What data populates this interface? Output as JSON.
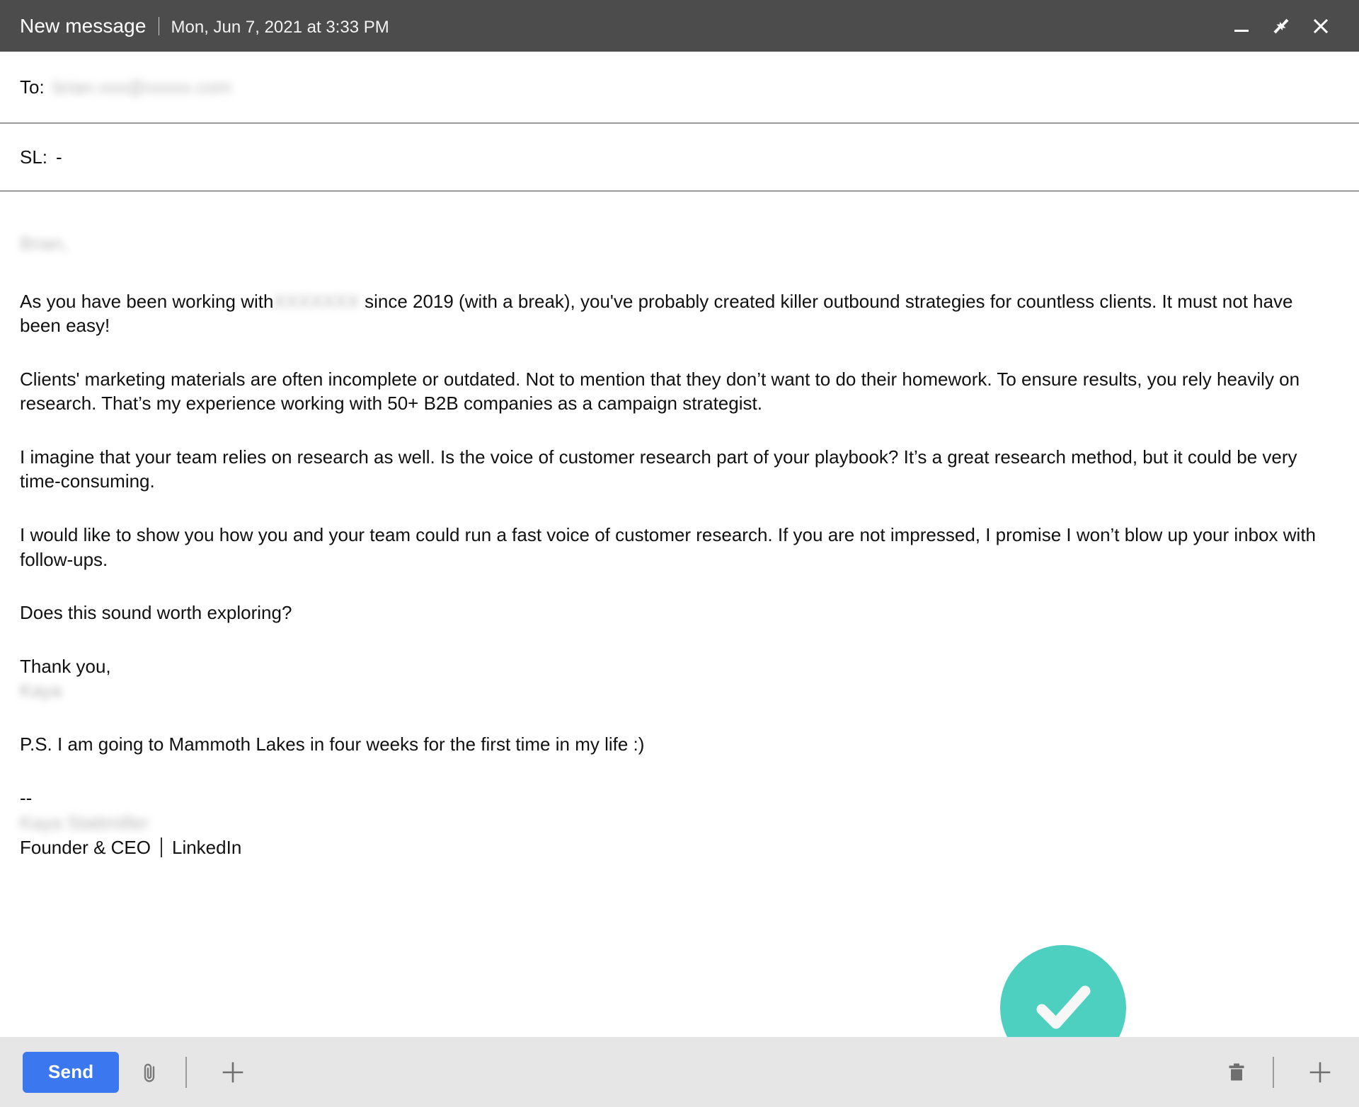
{
  "window": {
    "title": "New message",
    "separator": "|",
    "date": "Mon, Jun 7, 2021 at 3:33 PM",
    "controls": {
      "minimize": "minimize-icon",
      "collapse": "collapse-inward-icon",
      "close": "close-icon"
    }
  },
  "fields": {
    "to_label": "To:",
    "to_value": "brian.xxx@xxxxx.com",
    "sl_label": "SL:",
    "sl_value": "-"
  },
  "body": {
    "greeting": "Brian,",
    "paragraph_1_before": "As you have been working with",
    "paragraph_1_redacted": "XXXXXXX",
    "paragraph_1_after": "since 2019 (with a break), you've probably created killer outbound strategies for countless clients. It must not have been easy!",
    "paragraph_2": "Clients' marketing materials are often incomplete or outdated. Not to mention that they don’t want to do their homework. To ensure results, you rely heavily on research. That’s my experience working with 50+ B2B companies as a campaign strategist.",
    "paragraph_3": "I imagine that your team relies on research as well. Is the voice of customer research part of your playbook? It’s a great research method, but it could be very time-consuming.",
    "paragraph_4": "I would like to show you how you and your team could run a fast voice of customer research. If you are not impressed, I promise I won’t blow up your inbox with follow-ups.",
    "paragraph_5": "Does this sound worth exploring?",
    "closing": "Thank you,",
    "signer_first_name": "Kaya",
    "postscript": "P.S. I am going to Mammoth Lakes in four weeks for the first time in my life :)",
    "signature_dashes": "--",
    "signature_name": "Kaya Stattmiller",
    "signature_role": "Founder & CEO",
    "signature_sep": "|",
    "signature_link": "LinkedIn"
  },
  "overlay": {
    "status_icon": "success-check-icon",
    "status_color": "#4ed0c0",
    "check_color": "#f7f7f7"
  },
  "toolbar": {
    "send_label": "Send",
    "attach_icon": "paperclip-icon",
    "add_left_icon": "plus-icon",
    "delete_icon": "trash-icon",
    "add_right_icon": "plus-icon"
  },
  "colors": {
    "titlebar_bg": "#4c4c4c",
    "send_button": "#3b78f0",
    "toolbar_bg": "#e6e6e6",
    "body_text": "#111111",
    "divider": "#9a9a9a"
  }
}
